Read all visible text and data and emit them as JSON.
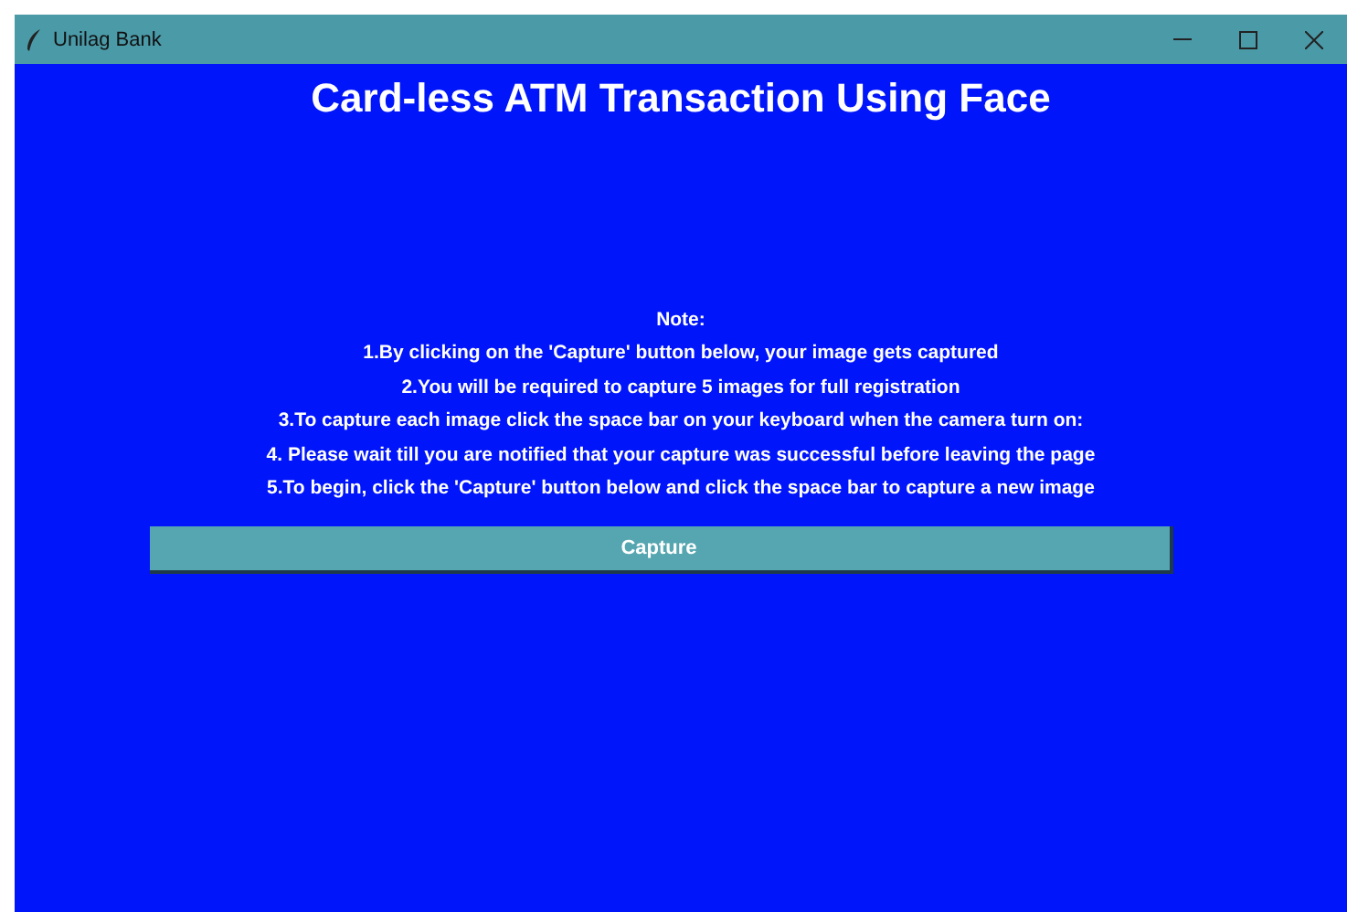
{
  "window": {
    "title": "Unilag Bank"
  },
  "heading": "Card-less ATM Transaction Using Face",
  "note": {
    "title": "Note:",
    "lines": [
      "1.By clicking on the 'Capture' button below, your image gets captured",
      "2.You will be required to capture 5 images for full registration",
      "3.To capture each image click the space bar on your keyboard when the camera turn on:",
      "4. Please wait till you are notified that your capture was successful before leaving the page",
      "5.To begin, click the 'Capture' button below and click the space bar to capture a new image"
    ]
  },
  "button": "Capture"
}
